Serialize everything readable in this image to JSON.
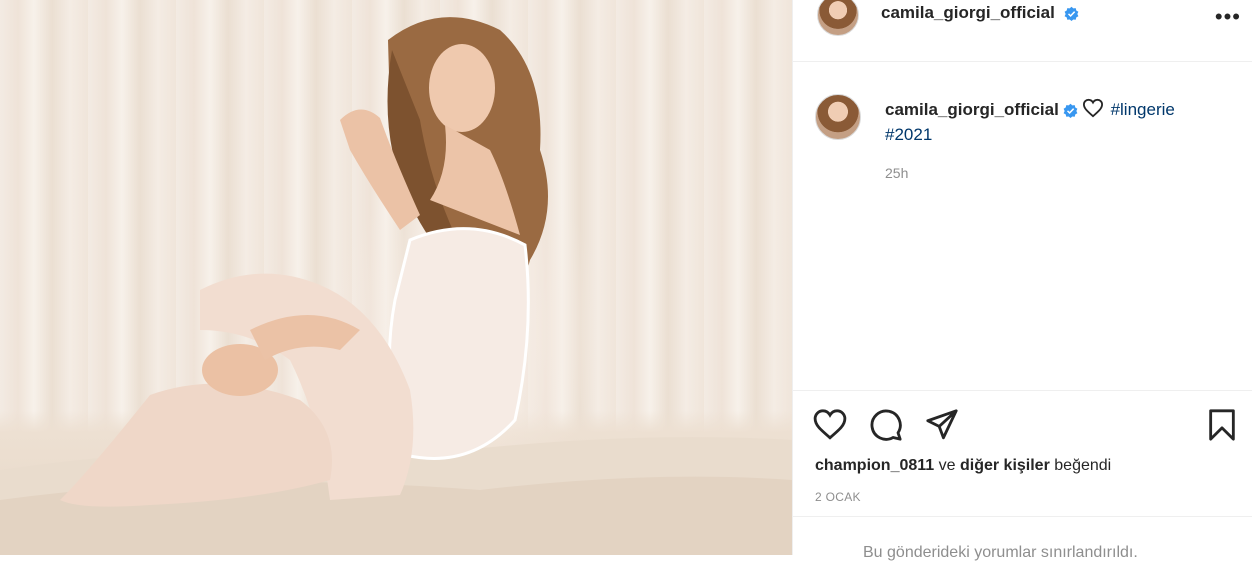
{
  "post": {
    "username": "camila_giorgi_official",
    "caption_hashtags": [
      "#lingerie",
      "#2021"
    ],
    "time_ago": "25h",
    "liked_by_user": "champion_0811",
    "liked_by_rest": "ve",
    "liked_by_others": "diğer kişiler",
    "liked_by_suffix": "beğendi",
    "date": "2 OCAK",
    "comments_notice": "Bu gönderideki yorumlar sınırlandırıldı."
  },
  "icons": {
    "more": "more-options-icon",
    "verified": "verified-badge-icon",
    "heart": "heart-icon",
    "comment": "comment-icon",
    "share": "share-icon",
    "save": "bookmark-icon"
  },
  "colors": {
    "verified": "#3897f0",
    "hashtag": "#00376b",
    "muted": "#8e8e8e"
  }
}
